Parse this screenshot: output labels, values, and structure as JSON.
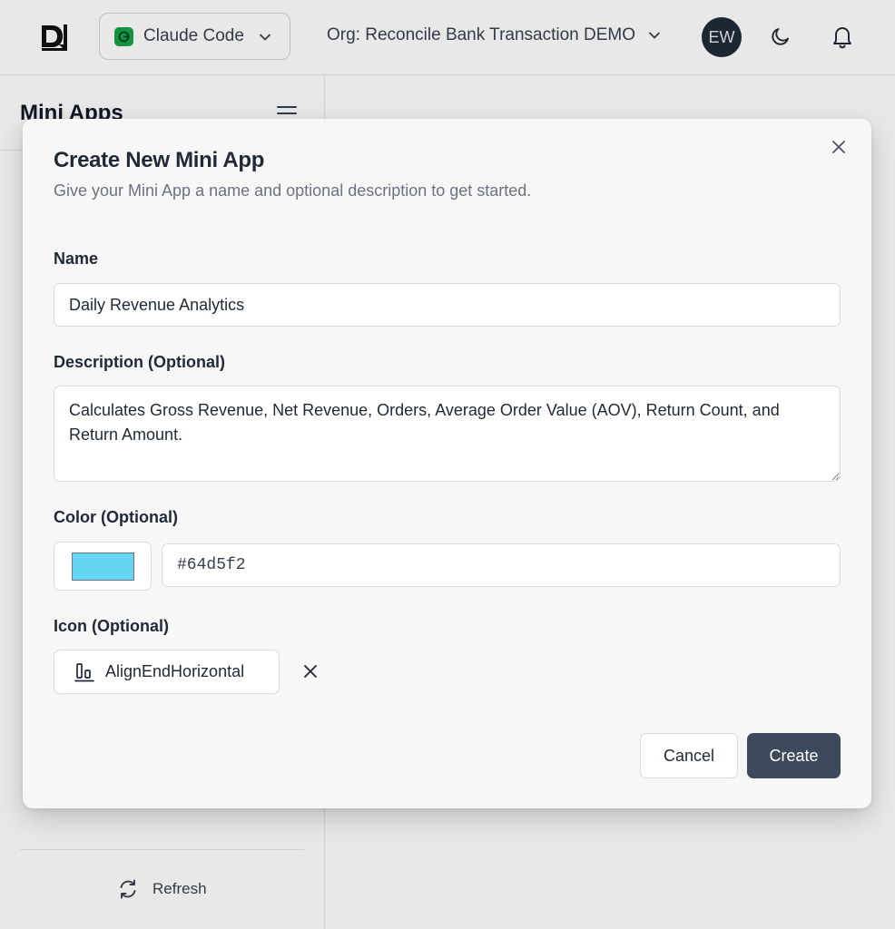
{
  "header": {
    "workspace": {
      "label": "Claude Code",
      "icon": "claude-icon",
      "icon_color": "#16a34a"
    },
    "org": {
      "label": "Org: Reconcile Bank Transaction DEMO"
    },
    "avatar": {
      "initials": "EW"
    },
    "icons": {
      "theme": "moon-icon",
      "notifications": "bell-icon"
    }
  },
  "sidebar": {
    "title": "Mini Apps",
    "refresh_label": "Refresh"
  },
  "modal": {
    "title": "Create New Mini App",
    "subtitle": "Give your Mini App a name and optional description to get started.",
    "name": {
      "label": "Name",
      "value": "Daily Revenue Analytics"
    },
    "description": {
      "label": "Description (Optional)",
      "value": "Calculates Gross Revenue, Net Revenue, Orders, Average Order Value (AOV), Return Count, and Return Amount."
    },
    "color": {
      "label": "Color (Optional)",
      "value": "#64d5f2",
      "swatch": "#64d5f2"
    },
    "icon": {
      "label": "Icon (Optional)",
      "value": "AlignEndHorizontal"
    },
    "buttons": {
      "cancel": "Cancel",
      "create": "Create"
    }
  },
  "colors": {
    "primary_button": "#3c4a5c",
    "avatar_bg": "#1f2b3a"
  }
}
